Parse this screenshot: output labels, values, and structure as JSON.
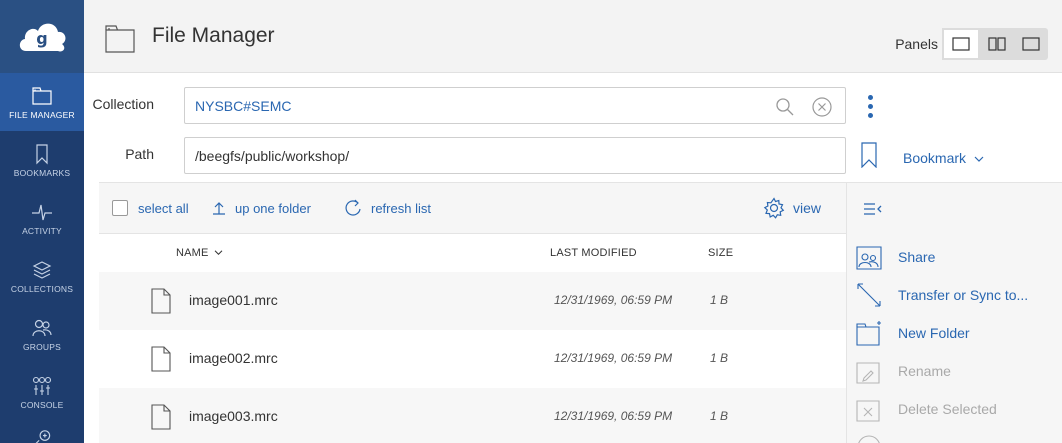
{
  "header": {
    "title": "File Manager",
    "panels_label": "Panels"
  },
  "sidebar": {
    "items": [
      {
        "label": "FILE MANAGER",
        "icon": "folder-icon",
        "active": true
      },
      {
        "label": "BOOKMARKS",
        "icon": "bookmark-icon"
      },
      {
        "label": "ACTIVITY",
        "icon": "activity-icon"
      },
      {
        "label": "COLLECTIONS",
        "icon": "collections-icon"
      },
      {
        "label": "GROUPS",
        "icon": "groups-icon"
      },
      {
        "label": "CONSOLE",
        "icon": "console-icon"
      }
    ]
  },
  "form": {
    "collection_label": "Collection",
    "collection_value": "NYSBC#SEMC",
    "path_label": "Path",
    "path_value": "/beegfs/public/workshop/",
    "bookmark_label": "Bookmark"
  },
  "toolbar": {
    "select_all": "select all",
    "up_one_folder": "up one folder",
    "refresh_list": "refresh list",
    "view": "view"
  },
  "columns": {
    "name": "NAME",
    "modified": "LAST MODIFIED",
    "size": "SIZE"
  },
  "files": [
    {
      "name": "image001.mrc",
      "modified": "12/31/1969, 06:59 PM",
      "size": "1 B"
    },
    {
      "name": "image002.mrc",
      "modified": "12/31/1969, 06:59 PM",
      "size": "1 B"
    },
    {
      "name": "image003.mrc",
      "modified": "12/31/1969, 06:59 PM",
      "size": "1 B"
    }
  ],
  "actions": {
    "share": "Share",
    "transfer": "Transfer or Sync to...",
    "new_folder": "New Folder",
    "rename": "Rename",
    "delete": "Delete Selected"
  },
  "colors": {
    "sidebar_bg": "#1e3d6e",
    "sidebar_active": "#2a5aa0",
    "accent": "#2a67b1",
    "disabled": "#a9a9a9"
  }
}
